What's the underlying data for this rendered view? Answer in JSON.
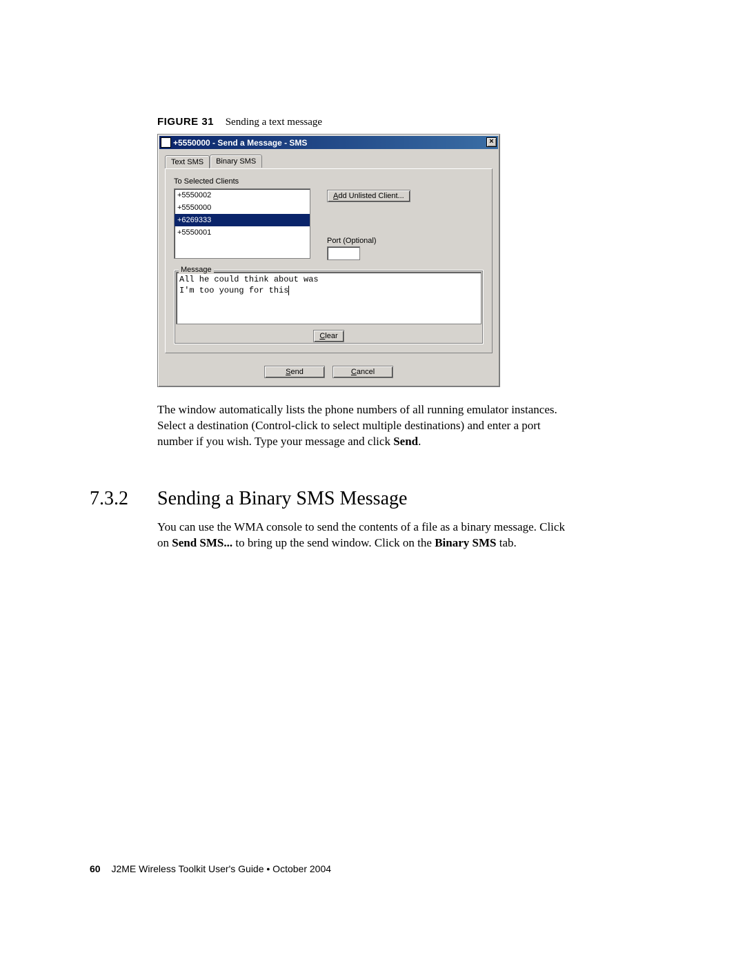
{
  "figure": {
    "label": "FIGURE 31",
    "title": "Sending a text message"
  },
  "window": {
    "title": "+5550000 - Send a Message - SMS",
    "close_glyph": "×",
    "tabs": {
      "text": "Text SMS",
      "binary": "Binary SMS"
    },
    "to_label": "To Selected Clients",
    "clients": [
      "+5550002",
      "+5550000",
      "+6269333",
      "+5550001"
    ],
    "selected_index": 2,
    "add_button_pre": "A",
    "add_button_rest": "dd Unlisted Client...",
    "port_label": "Port (Optional)",
    "message_legend": "Message",
    "message_line1": "All he could think about was",
    "message_line2": "I'm too young for this",
    "clear_pre": "C",
    "clear_rest": "lear",
    "send_pre": "S",
    "send_rest": "end",
    "cancel_pre": "C",
    "cancel_rest": "ancel"
  },
  "para1_a": "The window automatically lists the phone numbers of all running emulator instances. Select a destination (Control-click to select multiple destinations) and enter a port number if you wish. Type your message and click ",
  "para1_b": "Send",
  "para1_c": ".",
  "section": {
    "num": "7.3.2",
    "title": "Sending a Binary SMS Message"
  },
  "para2_a": "You can use the WMA console to send the contents of a file as a binary message. Click on ",
  "para2_b": "Send SMS...",
  "para2_c": " to bring up the send window. Click on the ",
  "para2_d": "Binary SMS",
  "para2_e": " tab.",
  "footer": {
    "page": "60",
    "text": "J2ME Wireless Toolkit User's Guide  •  October 2004"
  }
}
